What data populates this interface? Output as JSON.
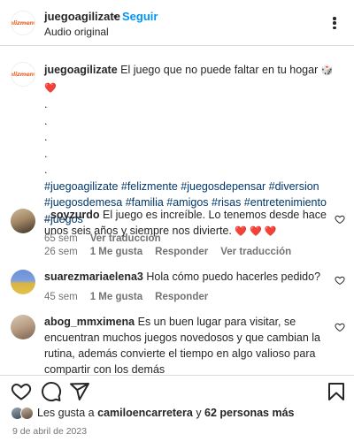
{
  "header": {
    "logo_text": "Felizmente",
    "username": "juegoagilizate",
    "separator": "•",
    "follow_label": "Seguir",
    "audio": "Audio original",
    "more_icon": "more-horizontal-icon"
  },
  "caption": {
    "username": "juegoagilizate",
    "text": "El juego que no puede faltar en tu hogar",
    "emojis": "🎲 ❤️",
    "dots": [
      ".",
      ".",
      ".",
      ".",
      "."
    ],
    "hashtags": "#juegoagilizate #felizmente #juegosdepensar #diversion #juegosdemesa #familia #amigos #risas #entretenimiento #juegos",
    "time": "65 sem",
    "translate": "Ver traducción"
  },
  "comments": [
    {
      "username": "_soyzurdo",
      "text": "El juego es increíble. Lo tenemos desde hace unos seis años y siempre nos divierte.",
      "hearts": "❤️ ❤️ ❤️",
      "time": "26 sem",
      "likes": "1 Me gusta",
      "reply": "Responder",
      "translate": "Ver traducción"
    },
    {
      "username": "suarezmariaelena3",
      "text": "Hola cómo puedo hacerles pedido?",
      "time": "45 sem",
      "likes": "1 Me gusta",
      "reply": "Responder"
    },
    {
      "username": "abog_mmximena",
      "text": "Es un buen lugar para visitar, se encuentran muchos juegos novedosos y que cambian la rutina, además convierte el tiempo en algo valioso para compartir con los demás"
    }
  ],
  "likes": {
    "prefix": "Les gusta a",
    "user": "camiloencarretera",
    "middle": "y",
    "others": "62 personas más"
  },
  "date": "9 de abril de 2023",
  "colors": {
    "accent": "#0095f6",
    "hashtag": "#00376b",
    "muted": "#737373",
    "heart": "#e0245e"
  }
}
